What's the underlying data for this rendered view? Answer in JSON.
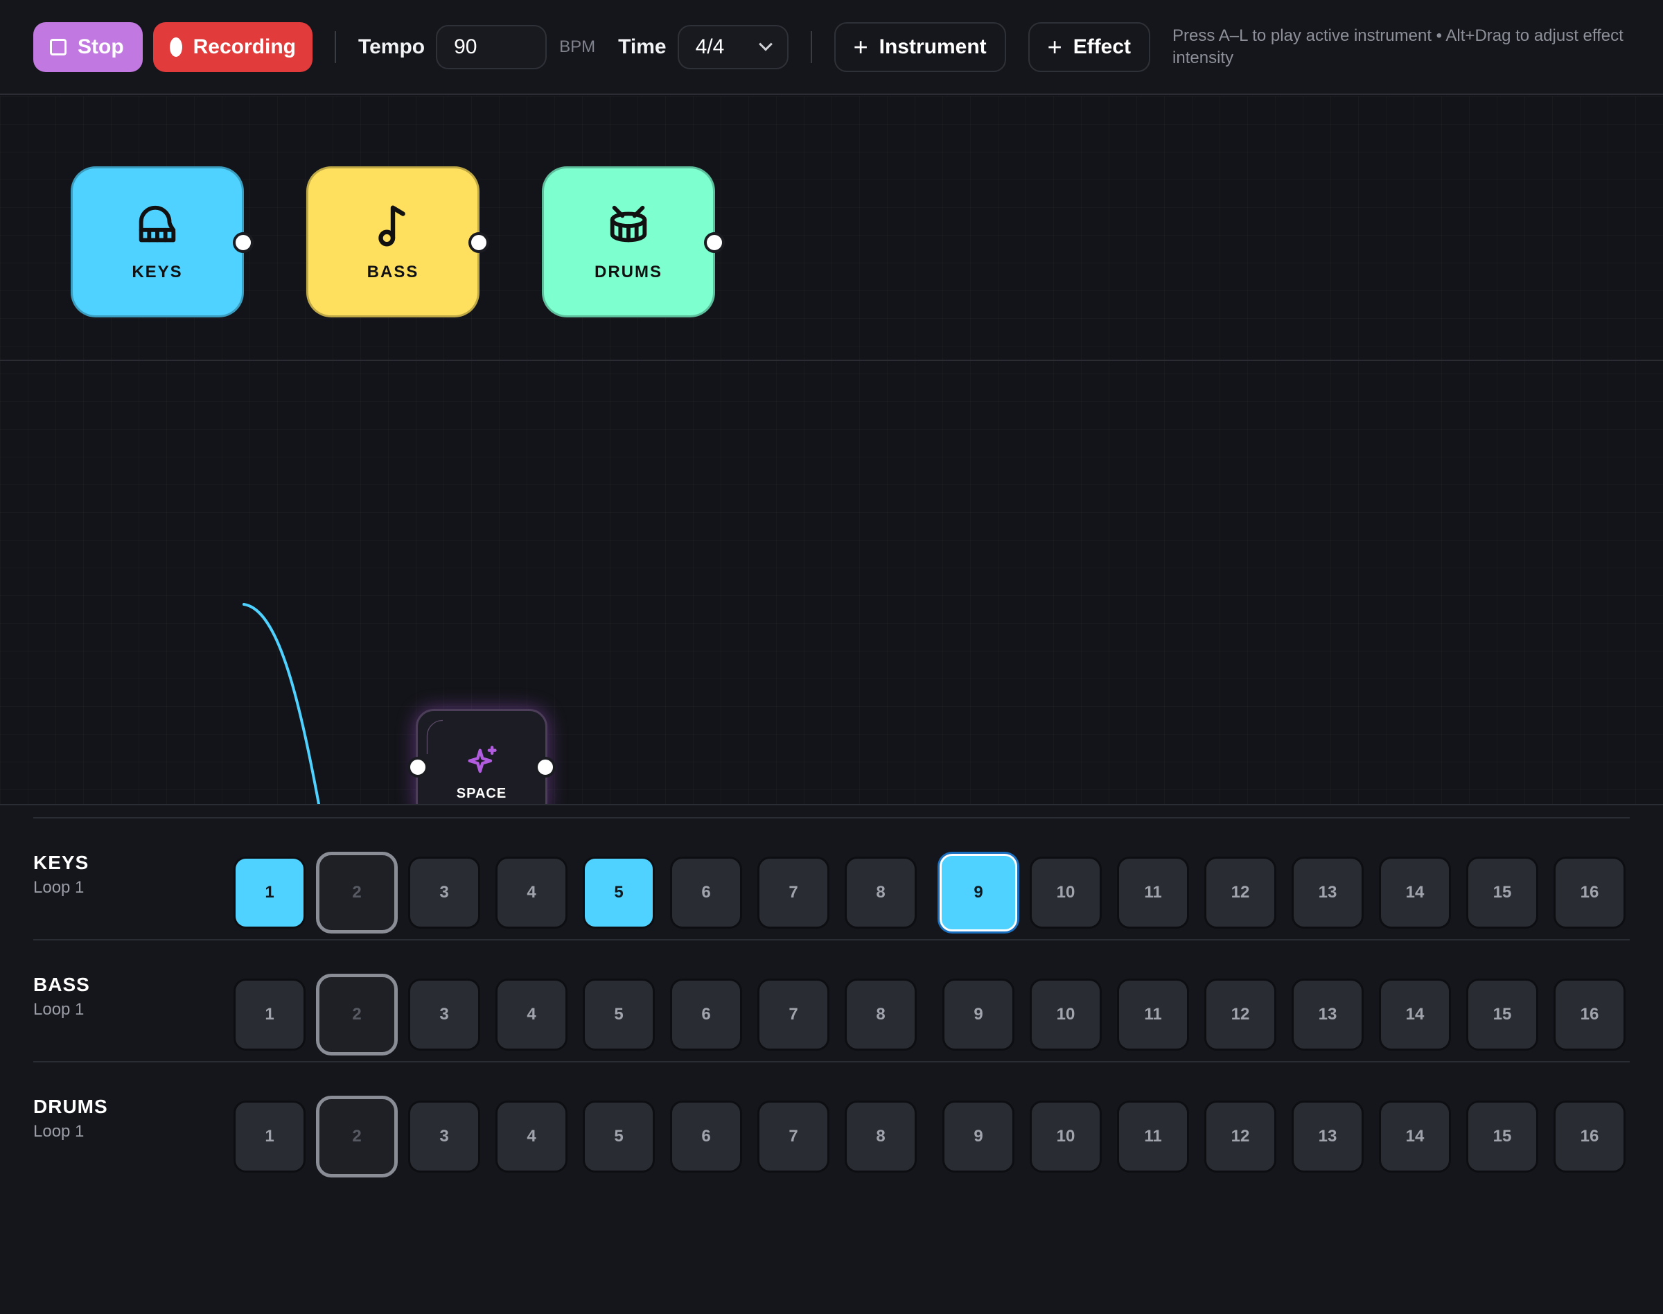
{
  "toolbar": {
    "stop_label": "Stop",
    "recording_label": "Recording",
    "tempo_label": "Tempo",
    "tempo_value": "90",
    "bpm_unit": "BPM",
    "time_label": "Time",
    "time_value": "4/4",
    "add_instrument_label": "Instrument",
    "add_effect_label": "Effect",
    "hint": "Press A–L to play active instrument • Alt+Drag to adjust effect intensity"
  },
  "instruments": [
    {
      "label": "KEYS",
      "color": "#4fd2ff",
      "icon": "piano-icon"
    },
    {
      "label": "BASS",
      "color": "#ffe05e",
      "icon": "music-note-icon"
    },
    {
      "label": "DRUMS",
      "color": "#7dffd0",
      "icon": "drum-icon"
    }
  ],
  "effect": {
    "label": "SPACE",
    "icon": "sparkle-icon",
    "accent": "#b25ce0"
  },
  "connection_color": "#4fd2ff",
  "tracks": [
    {
      "name": "KEYS",
      "loop": "Loop 1",
      "steps": [
        "1",
        "2",
        "3",
        "4",
        "5",
        "6",
        "7",
        "8",
        "9",
        "10",
        "11",
        "12",
        "13",
        "14",
        "15",
        "16"
      ],
      "active_steps": [
        1,
        5,
        9
      ],
      "selected_step": 9
    },
    {
      "name": "BASS",
      "loop": "Loop 1",
      "steps": [
        "1",
        "2",
        "3",
        "4",
        "5",
        "6",
        "7",
        "8",
        "9",
        "10",
        "11",
        "12",
        "13",
        "14",
        "15",
        "16"
      ],
      "active_steps": [],
      "selected_step": null
    },
    {
      "name": "DRUMS",
      "loop": "Loop 1",
      "steps": [
        "1",
        "2",
        "3",
        "4",
        "5",
        "6",
        "7",
        "8",
        "9",
        "10",
        "11",
        "12",
        "13",
        "14",
        "15",
        "16"
      ],
      "active_steps": [],
      "selected_step": null
    }
  ],
  "current_step": 2
}
